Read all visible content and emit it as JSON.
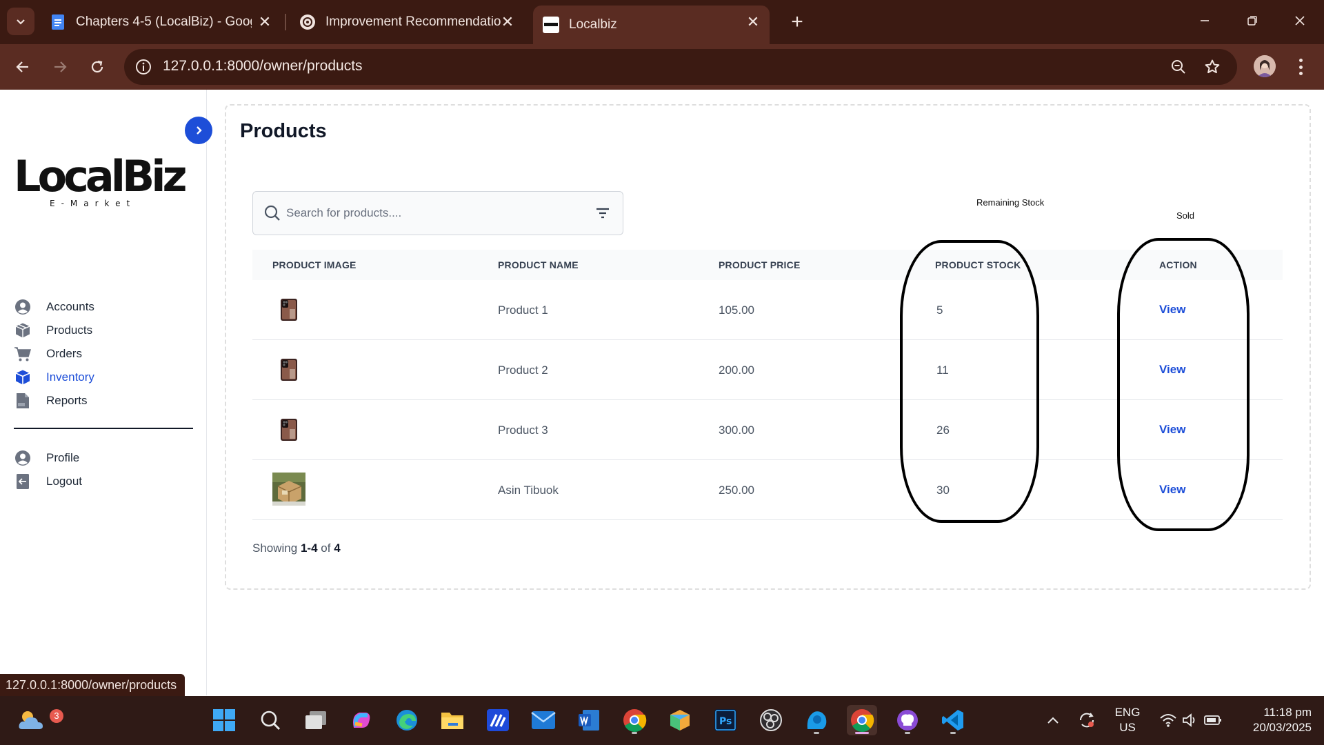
{
  "browser": {
    "tabs": [
      {
        "title": "Chapters 4-5 (LocalBiz) - Google Docs",
        "active": false
      },
      {
        "title": "Improvement Recommendations",
        "active": false
      },
      {
        "title": "Localbiz",
        "active": true
      }
    ],
    "url": "127.0.0.1:8000/owner/products",
    "status_url": "127.0.0.1:8000/owner/products"
  },
  "sidebar": {
    "brand": "LocalBiz",
    "tagline": "E-Market",
    "items": [
      {
        "label": "Accounts",
        "icon": "user-circle-icon"
      },
      {
        "label": "Products",
        "icon": "box-icon"
      },
      {
        "label": "Orders",
        "icon": "cart-icon"
      },
      {
        "label": "Inventory",
        "icon": "cube-icon",
        "active": true
      },
      {
        "label": "Reports",
        "icon": "pdf-file-icon"
      }
    ],
    "secondary": [
      {
        "label": "Profile",
        "icon": "user-circle-icon"
      },
      {
        "label": "Logout",
        "icon": "logout-icon"
      }
    ]
  },
  "main": {
    "title": "Products",
    "search": {
      "placeholder": "Search for products...."
    },
    "annotations": {
      "remaining_stock": "Remaining Stock",
      "sold": "Sold"
    },
    "columns": [
      "PRODUCT IMAGE",
      "PRODUCT NAME",
      "PRODUCT PRICE",
      "PRODUCT STOCK",
      "ACTION"
    ],
    "rows": [
      {
        "name": "Product 1",
        "price": "105.00",
        "stock": "5",
        "action": "View",
        "image": "phone"
      },
      {
        "name": "Product 2",
        "price": "200.00",
        "stock": "11",
        "action": "View",
        "image": "phone"
      },
      {
        "name": "Product 3",
        "price": "300.00",
        "stock": "26",
        "action": "View",
        "image": "phone"
      },
      {
        "name": "Asin Tibuok",
        "price": "250.00",
        "stock": "30",
        "action": "View",
        "image": "package"
      }
    ],
    "pagination": {
      "prefix": "Showing",
      "range": "1-4",
      "of": "of",
      "total": "4"
    }
  },
  "taskbar": {
    "weather_badge": "3",
    "lang": "ENG",
    "region": "US",
    "time": "11:18 pm",
    "date": "20/03/2025"
  },
  "colors": {
    "accent": "#1d4ed8",
    "chrome": "#3b1a12",
    "toolbar": "#5a2c22",
    "taskbar": "#2f1a16"
  }
}
